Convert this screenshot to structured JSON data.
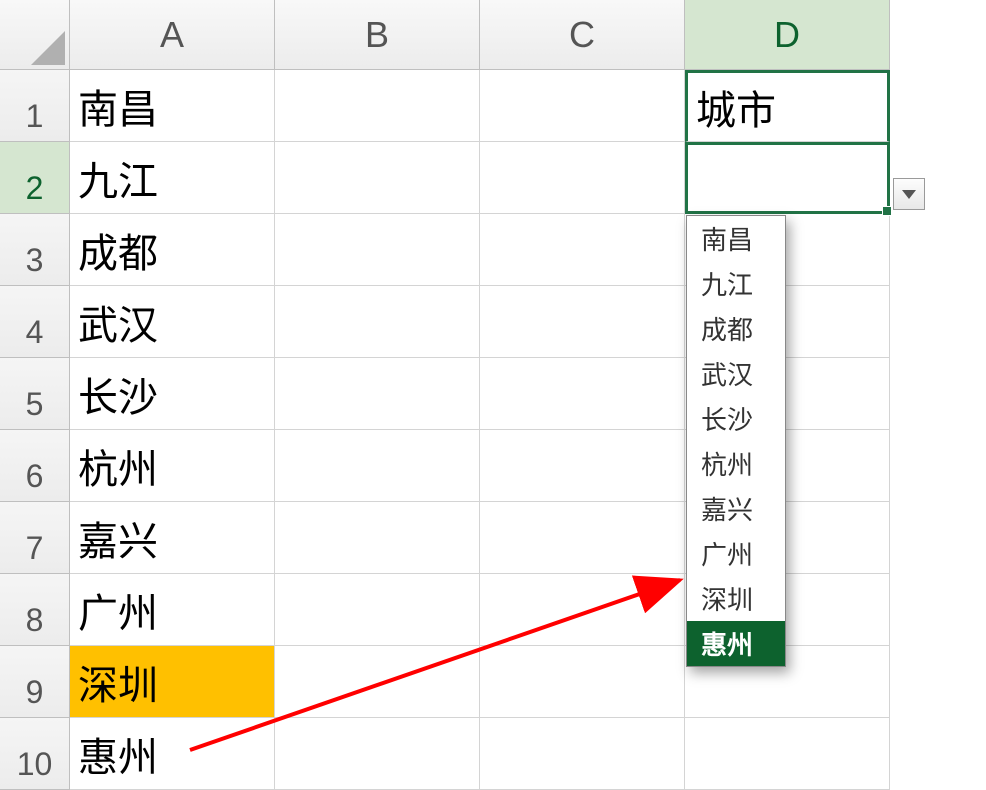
{
  "columns": [
    "A",
    "B",
    "C",
    "D"
  ],
  "rows": [
    "1",
    "2",
    "3",
    "4",
    "5",
    "6",
    "7",
    "8",
    "9",
    "10"
  ],
  "active_column_index": 3,
  "active_row_index": 1,
  "cells": {
    "A1": "南昌",
    "A2": "九江",
    "A3": "成都",
    "A4": "武汉",
    "A5": "长沙",
    "A6": "杭州",
    "A7": "嘉兴",
    "A8": "广州",
    "A9": "深圳",
    "A10": "惠州",
    "D1": "城市"
  },
  "highlighted_cell": "A9",
  "active_cell": "D2",
  "dropdown": {
    "items": [
      "南昌",
      "九江",
      "成都",
      "武汉",
      "长沙",
      "杭州",
      "嘉兴",
      "广州",
      "深圳",
      "惠州"
    ],
    "selected_index": 9
  },
  "colors": {
    "highlight": "#ffc000",
    "selection_border": "#217346",
    "dropdown_selected_bg": "#0d622e",
    "arrow": "#ff0000"
  }
}
